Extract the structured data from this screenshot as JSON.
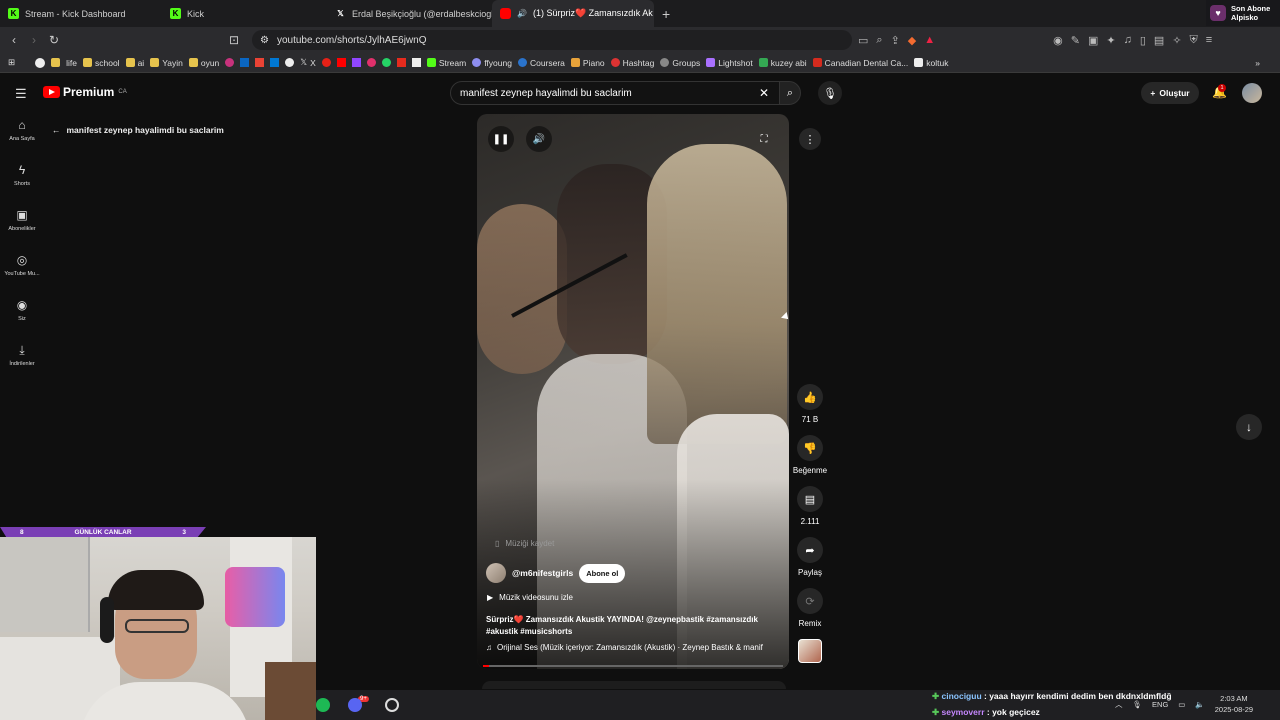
{
  "browser": {
    "tabs": [
      {
        "label": "Stream - Kick Dashboard",
        "icon": "kick-logo-icon"
      },
      {
        "label": "Kick",
        "icon": "kick-logo-icon"
      },
      {
        "label": "Erdal Beşikçioğlu (@erdalbeskcioglu",
        "icon": "x-logo-icon"
      },
      {
        "label": "(1) Sürpriz❤️ Zamansızdık Ak",
        "icon": "youtube-icon",
        "active": true
      }
    ],
    "url": "youtube.com/shorts/JylhAE6jwnQ",
    "bookmarks": [
      "life",
      "school",
      "ai",
      "Yayin",
      "oyun",
      "X",
      "Stream",
      "ffyoung",
      "Coursera",
      "Piano",
      "Hashtag",
      "Groups",
      "Lightshot",
      "kuzey abi",
      "Canadian Dental Ca...",
      "koltuk"
    ]
  },
  "youtube": {
    "logo_text": "Premium",
    "logo_region": "CA",
    "search_value": "manifest zeynep hayalimdi bu saclarim",
    "create_label": "Oluştur",
    "notification_count": "1",
    "sidebar": [
      {
        "label": "Ana Sayfa",
        "icon": "home-icon"
      },
      {
        "label": "Shorts",
        "icon": "shorts-icon"
      },
      {
        "label": "Abonelikler",
        "icon": "subscriptions-icon"
      },
      {
        "label": "YouTube Mu...",
        "icon": "youtube-music-icon"
      },
      {
        "label": "Siz",
        "icon": "user-icon"
      },
      {
        "label": "İndirilenler",
        "icon": "download-icon"
      }
    ],
    "back_title": "manifest zeynep hayalimdi bu saclarim",
    "short": {
      "save_music": "Müziği kaydet",
      "channel": "@m6nifestgirls",
      "subscribe": "Abone ol",
      "watch_music_video": "Müzik videosunu izle",
      "description": "Sürpriz❤️ Zamansızdık Akustik YAYINDA! @zeynepbastik #zamansızdık #akustik #musicshorts",
      "sound": "Orijinal Ses (Müzik içeriyor: Zamansızdık (Akustik) · Zeynep Bastık & manif",
      "progress": 0.02
    },
    "actions": {
      "likes": "71 B",
      "dislike": "Beğenme",
      "comments": "2.111",
      "share": "Paylaş",
      "remix": "Remix"
    }
  },
  "stream_overlay": {
    "sub_alert_title": "Son Abone",
    "sub_alert_user": "Alpisko",
    "lives_label": "GÜNLÜK CANLAR",
    "lives_left": "8",
    "lives_right": "3",
    "chat": [
      {
        "user": "cinociguu",
        "message": "yaaa hayırr kendimi dedim ben dkdnxldmfldğ"
      },
      {
        "user": "seymoverr",
        "message": "yok geçicez"
      }
    ],
    "discord_badge": "9+"
  },
  "taskbar": {
    "language": "ENG",
    "time": "2:03 AM",
    "date": "2025-08-29"
  },
  "colors": {
    "accent": "#ff0000",
    "kick_green": "#53fc18",
    "lives_purple": "#7a3fb5"
  }
}
